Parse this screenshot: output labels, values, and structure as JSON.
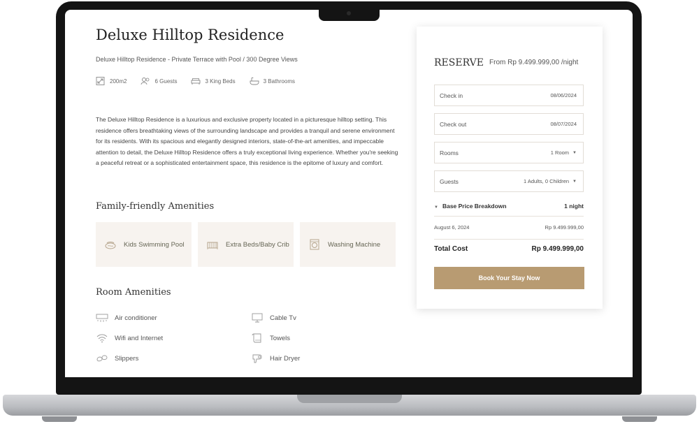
{
  "property": {
    "title": "Deluxe Hilltop Residence",
    "subtitle": "Deluxe Hilltop Residence - Private Terrace with Pool / 300 Degree Views",
    "specs": [
      {
        "icon": "size-icon",
        "label": "200m2"
      },
      {
        "icon": "guests-icon",
        "label": "6 Guests"
      },
      {
        "icon": "bed-icon",
        "label": "3 King Beds"
      },
      {
        "icon": "bath-icon",
        "label": "3 Bathrooms"
      }
    ],
    "description": "The Deluxe Hilltop Residence is a luxurious and exclusive property located in a picturesque hilltop setting. This residence offers breathtaking views of the surrounding landscape and provides a tranquil and serene environment for its residents. With its spacious and elegantly designed interiors, state-of-the-art amenities, and impeccable attention to detail, the Deluxe Hilltop Residence offers a truly exceptional living experience. Whether you're seeking a peaceful retreat or a sophisticated entertainment space, this residence is the epitome of luxury and comfort."
  },
  "family_amenities": {
    "heading": "Family-friendly Amenities",
    "items": [
      {
        "icon": "swimming-pool-icon",
        "label": "Kids Swimming Pool"
      },
      {
        "icon": "crib-icon",
        "label": "Extra Beds/Baby Crib"
      },
      {
        "icon": "washing-machine-icon",
        "label": "Washing Machine"
      }
    ]
  },
  "room_amenities": {
    "heading": "Room Amenities",
    "left": [
      {
        "icon": "air-conditioner-icon",
        "label": "Air conditioner"
      },
      {
        "icon": "wifi-icon",
        "label": "Wifi and Internet"
      },
      {
        "icon": "slippers-icon",
        "label": "Slippers"
      }
    ],
    "right": [
      {
        "icon": "tv-icon",
        "label": "Cable Tv"
      },
      {
        "icon": "towel-icon",
        "label": "Towels"
      },
      {
        "icon": "hair-dryer-icon",
        "label": "Hair Dryer"
      }
    ]
  },
  "reservation": {
    "heading": "RESERVE",
    "from_price": "From Rp 9.499.999,00 /night",
    "check_in": {
      "label": "Check in",
      "value": "08/06/2024"
    },
    "check_out": {
      "label": "Check out",
      "value": "08/07/2024"
    },
    "rooms": {
      "label": "Rooms",
      "value": "1 Room"
    },
    "guests": {
      "label": "Guests",
      "value": "1 Adults, 0 Children"
    },
    "breakdown": {
      "label": "Base Price Breakdown",
      "nights": "1 night"
    },
    "line_item": {
      "date": "August 6, 2024",
      "price": "Rp 9.499.999,00"
    },
    "total": {
      "label": "Total Cost",
      "value": "Rp 9.499.999,00"
    },
    "book_label": "Book Your Stay Now"
  },
  "colors": {
    "accent": "#b89b72",
    "card_bg": "#f7f3ef"
  }
}
